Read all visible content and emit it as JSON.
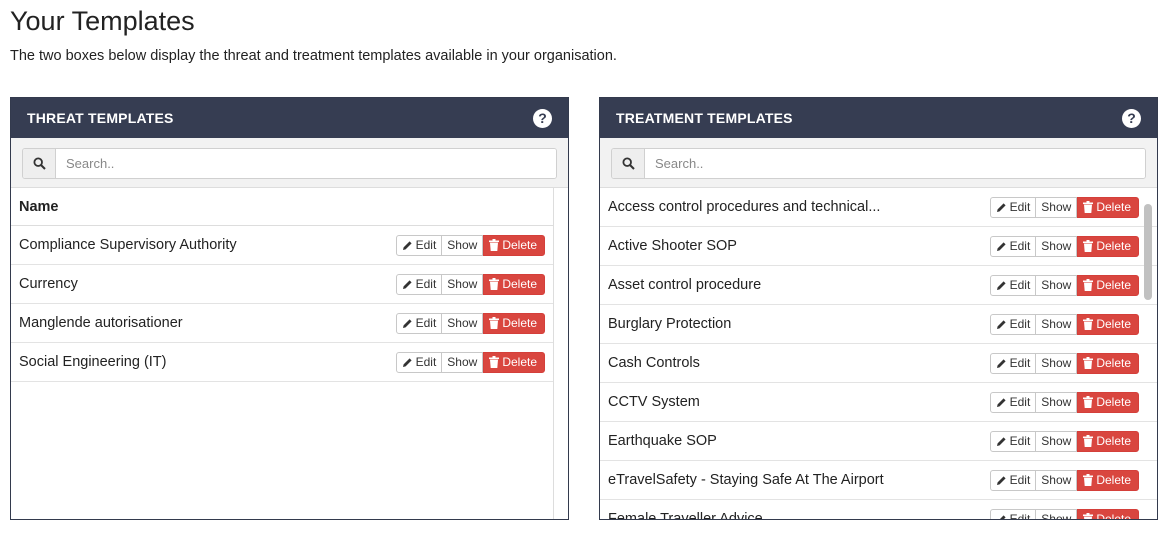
{
  "page": {
    "title": "Your Templates",
    "subtitle": "The two boxes below display the threat and treatment templates available in your organisation."
  },
  "threat": {
    "title": "THREAT TEMPLATES",
    "help_icon": "question-circle-icon",
    "search_placeholder": "Search..",
    "column_header": "Name",
    "rows": [
      "Compliance Supervisory Authority",
      "Currency",
      "Manglende autorisationer",
      "Social Engineering (IT)"
    ]
  },
  "treatment": {
    "title": "TREATMENT TEMPLATES",
    "help_icon": "question-circle-icon",
    "search_placeholder": "Search..",
    "rows": [
      "Access control procedures and technical...",
      "Active Shooter SOP",
      "Asset control procedure",
      "Burglary Protection",
      "Cash Controls",
      "CCTV System",
      "Earthquake SOP",
      "eTravelSafety - Staying Safe At The Airport",
      "Female Traveller Advice"
    ]
  },
  "buttons": {
    "edit": "Edit",
    "show": "Show",
    "delete": "Delete"
  },
  "colors": {
    "header_bg": "#363d52",
    "delete_bg": "#d9463f"
  }
}
